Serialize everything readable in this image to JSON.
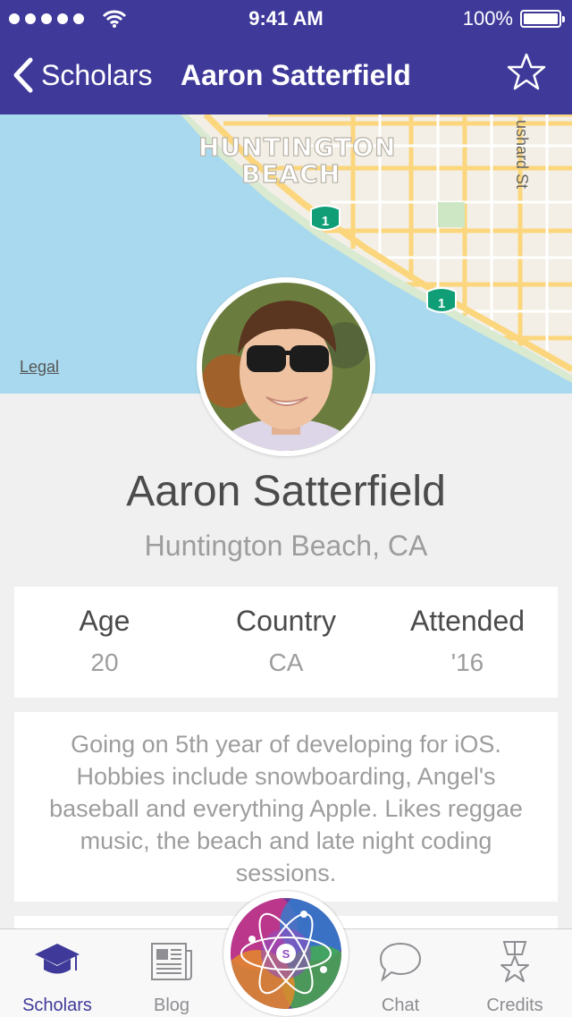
{
  "status_bar": {
    "time": "9:41 AM",
    "battery": "100%",
    "signal_bars": 5
  },
  "nav": {
    "back_label": "Scholars",
    "title": "Aaron Satterfield",
    "favorite_icon": "star-outline-icon"
  },
  "map": {
    "place_line1": "HUNTINGTON",
    "place_line2": "BEACH",
    "street_label": "ushard St",
    "route_shields": [
      "1",
      "1"
    ],
    "legal": "Legal"
  },
  "profile": {
    "name": "Aaron Satterfield",
    "location": "Huntington Beach, CA",
    "stats": [
      {
        "label": "Age",
        "value": "20"
      },
      {
        "label": "Country",
        "value": "CA"
      },
      {
        "label": "Attended",
        "value": "'16"
      }
    ],
    "bio": "Going on 5th year of developing for iOS. Hobbies include snowboarding, Angel's baseball and everything Apple. Likes reggae music, the beach and late night coding sessions."
  },
  "tabs": [
    {
      "label": "Scholars",
      "icon": "graduation-cap-icon",
      "active": true
    },
    {
      "label": "Blog",
      "icon": "newspaper-icon",
      "active": false
    },
    {
      "label": "",
      "icon": "wwdc-atom-icon",
      "active": false
    },
    {
      "label": "Chat",
      "icon": "speech-bubble-icon",
      "active": false
    },
    {
      "label": "Credits",
      "icon": "medal-icon",
      "active": false
    }
  ],
  "colors": {
    "accent": "#3f3a9a",
    "water": "#a9d9ee",
    "land": "#f3efe6",
    "road": "#fbd67c"
  }
}
